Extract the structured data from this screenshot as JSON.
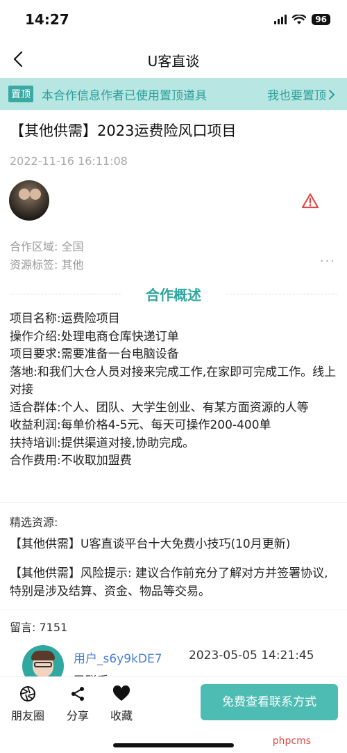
{
  "status_bar": {
    "time": "14:27",
    "battery": "96"
  },
  "nav": {
    "title": "U客直谈"
  },
  "pin_banner": {
    "tag": "置顶",
    "text": "本合作信息作者已使用置顶道具",
    "action": "我也要置顶"
  },
  "post": {
    "title": "【其他供需】2023运费险风口项目",
    "time": "2022-11-16 16:11:08",
    "region_label": "合作区域:",
    "region_value": "全国",
    "tag_label": "资源标签:",
    "tag_value": "其他"
  },
  "overview": {
    "heading": "合作概述",
    "lines": [
      "项目名称:运费险项目",
      "操作介绍:处理电商仓库快递订单",
      "项目要求:需要准备一台电脑设备",
      "落地:和我们大仓人员对接来完成工作,在家即可完成工作。线上对接",
      "适合群体:个人、团队、大学生创业、有某方面资源的人等",
      "收益利润:每单价格4-5元、每天可操作200-400单",
      "扶持培训:提供渠道对接,协助完成。",
      "合作费用:不收取加盟费"
    ]
  },
  "featured": {
    "label": "精选资源:",
    "items": [
      "【其他供需】U客直谈平台十大免费小技巧(10月更新)",
      "【其他供需】风险提示: 建议合作前充分了解对方并签署协议,特别是涉及结算、资金、物品等交易。"
    ]
  },
  "comments": {
    "count_label": "留言: 7151",
    "items": [
      {
        "user": "用户_s6y9kDE7",
        "time": "2023-05-05 14:21:45",
        "text": "已联系"
      }
    ]
  },
  "bottom_bar": {
    "moments": "朋友圈",
    "share": "分享",
    "favorite": "收藏",
    "contact": "免费查看联系方式",
    "watermark": "phpcms"
  },
  "colors": {
    "accent": "#2ea59f",
    "banner_bg": "#b7e6e3",
    "button": "#4dbcb3",
    "link": "#4a7fd2"
  }
}
